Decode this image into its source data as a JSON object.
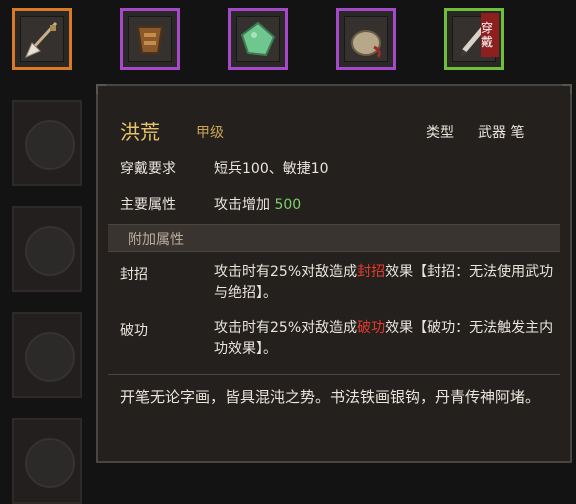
{
  "equipment_bar": {
    "slots": [
      {
        "name": "spear",
        "border": "#d97a26"
      },
      {
        "name": "armor",
        "border": "#a548c9"
      },
      {
        "name": "jade",
        "border": "#a548c9"
      },
      {
        "name": "pouch",
        "border": "#a548c9"
      },
      {
        "name": "brush",
        "border": "#6fbf3a",
        "badge": "穿戴"
      }
    ]
  },
  "tooltip": {
    "item_name": "洪荒",
    "grade": "甲级",
    "type_label": "类型",
    "type_value": "武器 笔",
    "requirement_label": "穿戴要求",
    "requirement_value": "短兵100、敏捷10",
    "main_attr_label": "主要属性",
    "main_attr_text": "攻击增加",
    "main_attr_value": "500",
    "extra_section": "附加属性",
    "extras": [
      {
        "name": "封招",
        "pre": "攻击时有25%对敌造成",
        "keyword": "封招",
        "post": "效果【封招：无法使用武功与绝招】。"
      },
      {
        "name": "破功",
        "pre": "攻击时有25%对敌造成",
        "keyword": "破功",
        "post": "效果【破功：无法触发主内功效果】。"
      }
    ],
    "description": "开笔无论字画，皆具混沌之势。书法铁画银钩，丹青传神阿堵。"
  },
  "colors": {
    "title": "#e7c46a",
    "grade": "#c9a455",
    "value_green": "#7bd06a",
    "keyword_red": "#e33b2e",
    "equip_badge": "#8e1f1f"
  }
}
